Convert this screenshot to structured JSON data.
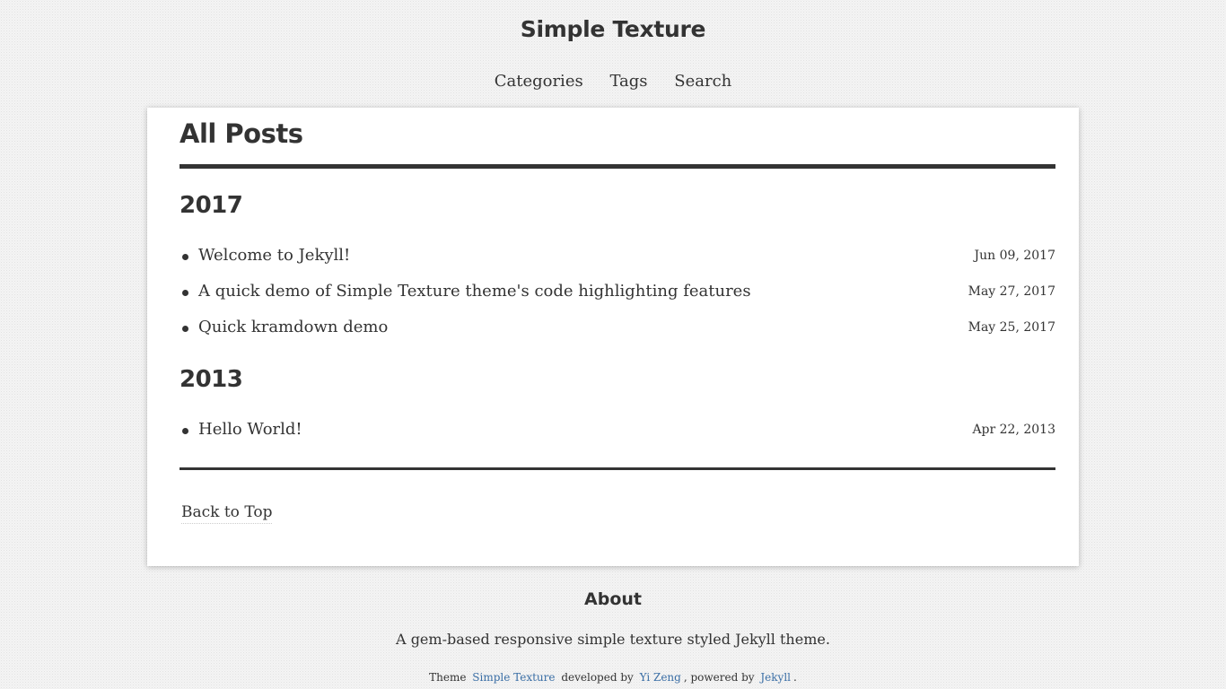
{
  "header": {
    "site_title": "Simple Texture",
    "nav": [
      {
        "label": "Categories"
      },
      {
        "label": "Tags"
      },
      {
        "label": "Search"
      }
    ]
  },
  "main": {
    "heading": "All Posts",
    "years": [
      {
        "year": "2017",
        "posts": [
          {
            "title": "Welcome to Jekyll!",
            "date": "Jun 09, 2017"
          },
          {
            "title": "A quick demo of Simple Texture theme's code highlighting features",
            "date": "May 27, 2017"
          },
          {
            "title": "Quick kramdown demo",
            "date": "May 25, 2017"
          }
        ]
      },
      {
        "year": "2013",
        "posts": [
          {
            "title": "Hello World!",
            "date": "Apr 22, 2013"
          }
        ]
      }
    ],
    "back_to_top": "Back to Top"
  },
  "footer": {
    "about_heading": "About",
    "about_text": "A gem-based responsive simple texture styled Jekyll theme.",
    "credits": {
      "theme_prefix": "Theme",
      "theme_link": "Simple Texture",
      "developed_by": "developed by",
      "author_link": "Yi Zeng",
      "powered_by": ", powered by",
      "engine_link": "Jekyll",
      "end": "."
    }
  },
  "colors": {
    "text": "#333333",
    "link_accent": "#3a6ea5",
    "card_bg": "#ffffff",
    "page_bg": "#f4f4f4"
  }
}
